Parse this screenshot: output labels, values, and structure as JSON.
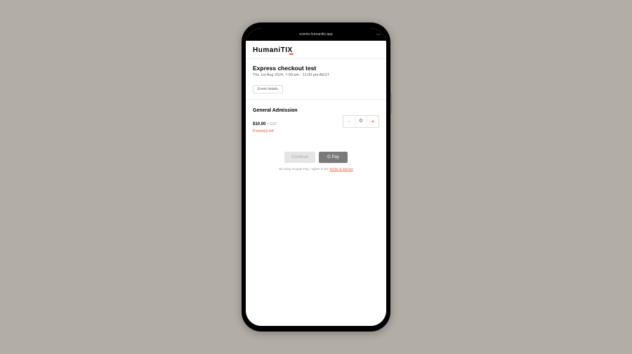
{
  "browser": {
    "url": "events.humanitix.app"
  },
  "logo": {
    "text": "HumaniTIX"
  },
  "event": {
    "title": "Express checkout test",
    "datetime": "Thu 1st Aug 2024, 7:00 pm - 11:00 pm AEST",
    "details_button": "Event details"
  },
  "ticket": {
    "name": "General Admission",
    "price": "$10.00",
    "gst": " + GST",
    "remaining": "8 ticket(s) left",
    "quantity": "0"
  },
  "checkout": {
    "continue_label": "Continue",
    "gpay_label": "G Pay",
    "terms_prefix": "By using Google Pay, I agree to the ",
    "terms_link": "Terms of Service"
  },
  "colors": {
    "accent": "#e85a2a",
    "background": "#b3ada7"
  }
}
